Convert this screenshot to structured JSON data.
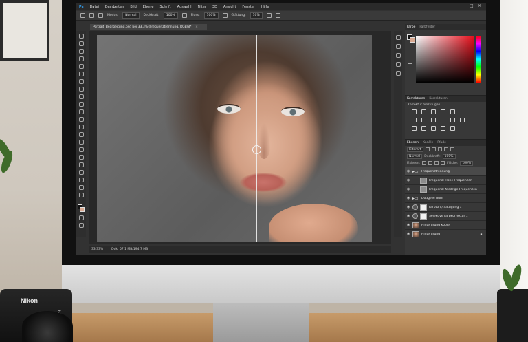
{
  "camera": {
    "brand": "Nikon",
    "model_mark": "Z"
  },
  "photoshop": {
    "app_logo": "Ps",
    "menu": [
      "Datei",
      "Bearbeiten",
      "Bild",
      "Ebene",
      "Schrift",
      "Auswahl",
      "Filter",
      "3D",
      "Ansicht",
      "Fenster",
      "Hilfe"
    ],
    "options": {
      "mode_label": "Modus:",
      "mode_value": "Normal",
      "opacity_label": "Deckkraft:",
      "opacity_value": "100%",
      "flow_label": "Fluss:",
      "flow_value": "100%",
      "smoothing_label": "Glättung:",
      "smoothing_value": "10%"
    },
    "document_tab": "Portrait_Bearbeitung.psd bei 33,3% (Frequenztrennung, RGB/8*)",
    "status": {
      "zoom": "33,33%",
      "doc": "Dok: 57,1 MB/194,7 MB"
    },
    "panels": {
      "color_tabs": [
        "Farbe",
        "Farbfelder"
      ],
      "adjust_tabs": [
        "Korrekturen",
        "Korrekturen"
      ],
      "adjust_subtitle": "Korrektur hinzufügen",
      "layer_tabs": [
        "Ebenen",
        "Kanäle",
        "Pfade"
      ],
      "kind_filter": "Filterart",
      "blend_mode": "Normal",
      "opacity_label": "Deckkraft:",
      "opacity_value": "100%",
      "lock_label": "Fixieren:",
      "fill_label": "Fläche:",
      "fill_value": "100%",
      "layers": [
        {
          "name": "Frequenztrennung",
          "type": "folder",
          "selected": true
        },
        {
          "name": "Frequenz: Hohe Frequenzen",
          "type": "gray",
          "indent": true
        },
        {
          "name": "Frequenz: Niedrige Frequenzen",
          "type": "gray",
          "indent": true
        },
        {
          "name": "Dodge & Burn",
          "type": "folder"
        },
        {
          "name": "Farbton / Sättigung 1",
          "type": "adjust"
        },
        {
          "name": "Selektive Farbkorrektur 1",
          "type": "adjust"
        },
        {
          "name": "Hintergrund Kopie",
          "type": "photo"
        },
        {
          "name": "Hintergrund",
          "type": "photo"
        }
      ]
    }
  }
}
